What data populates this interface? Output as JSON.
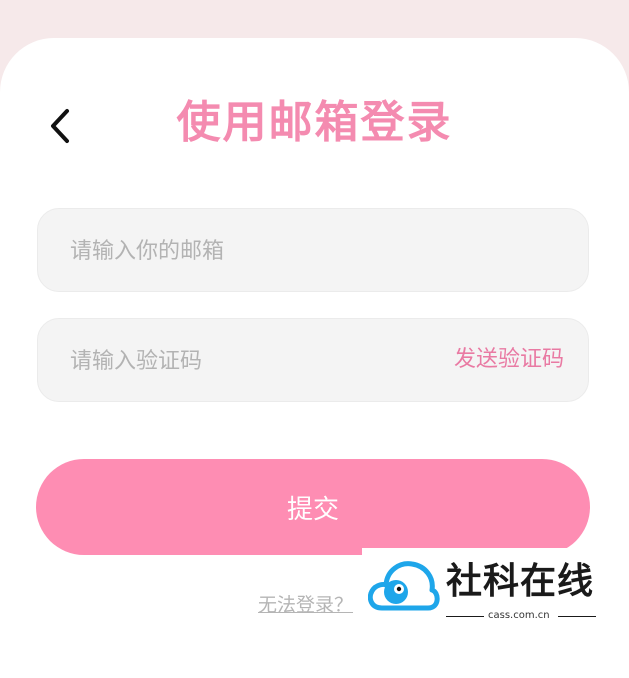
{
  "header": {
    "title": "使用邮箱登录",
    "back_icon": "chevron-left-icon"
  },
  "form": {
    "email_placeholder": "请输入你的邮箱",
    "code_placeholder": "请输入验证码",
    "send_code_label": "发送验证码",
    "submit_label": "提交"
  },
  "footer": {
    "cant_login_label": "无法登录？"
  },
  "watermark": {
    "name": "社科在线",
    "url": "cass.com.cn"
  },
  "colors": {
    "accent": "#fe8db3",
    "title": "#f48bb0",
    "link": "#e97aa3",
    "background": "#f6e9ea",
    "field": "#f4f4f4",
    "watermark_blue": "#1ea6ea"
  }
}
